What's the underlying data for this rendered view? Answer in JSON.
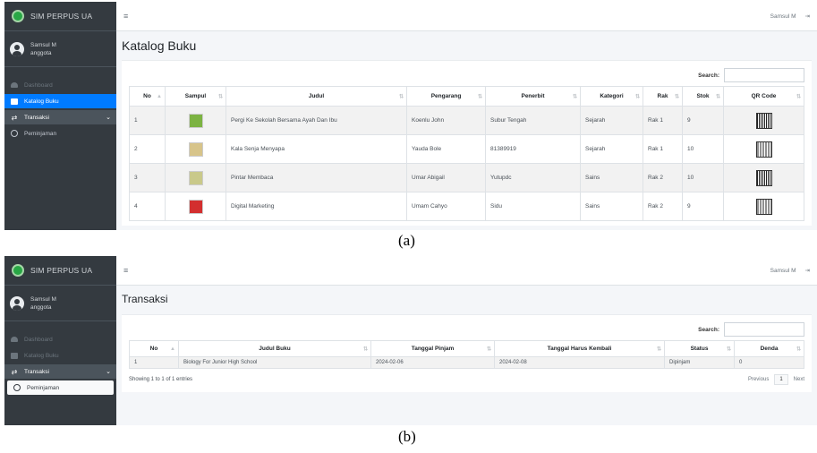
{
  "panel_a": {
    "brand": "SIM PERPUS UA",
    "user": {
      "name": "Samsul M",
      "role": "anggota"
    },
    "nav": [
      {
        "label": "Dashboard",
        "icon": "dashboard-icon"
      },
      {
        "label": "Katalog Buku",
        "icon": "book-icon"
      },
      {
        "label": "Transaksi",
        "icon": "exchange-icon"
      },
      {
        "label": "Peminjaman",
        "icon": "circle-icon"
      }
    ],
    "topbar_user": "Samsul M",
    "page_title": "Katalog Buku",
    "search_label": "Search:",
    "columns": [
      "No",
      "Sampul",
      "Judul",
      "Pengarang",
      "Penerbit",
      "Kategori",
      "Rak",
      "Stok",
      "QR Code"
    ],
    "rows": [
      {
        "no": "1",
        "cover_color": "#7cb342",
        "judul": "Pergi Ke Sekolah Bersama Ayah Dan Ibu",
        "pengarang": "Koenlu John",
        "penerbit": "Subur Tengah",
        "kategori": "Sejarah",
        "rak": "Rak 1",
        "stok": "9"
      },
      {
        "no": "2",
        "cover_color": "#d7c48a",
        "judul": "Kala Senja Menyapa",
        "pengarang": "Yauda Bole",
        "penerbit": "81389919",
        "kategori": "Sejarah",
        "rak": "Rak 1",
        "stok": "10"
      },
      {
        "no": "3",
        "cover_color": "#c9c98a",
        "judul": "Pintar Membaca",
        "pengarang": "Umar Abigail",
        "penerbit": "Yutupdc",
        "kategori": "Sains",
        "rak": "Rak 2",
        "stok": "10"
      },
      {
        "no": "4",
        "cover_color": "#d32f2f",
        "judul": "Digital Marketing",
        "pengarang": "Umam Cahyo",
        "penerbit": "Sidu",
        "kategori": "Sains",
        "rak": "Rak 2",
        "stok": "9"
      }
    ],
    "caption": "(a)"
  },
  "panel_b": {
    "brand": "SIM PERPUS UA",
    "user": {
      "name": "Samsul M",
      "role": "anggota"
    },
    "nav": [
      {
        "label": "Dashboard",
        "icon": "dashboard-icon"
      },
      {
        "label": "Katalog Buku",
        "icon": "book-icon"
      },
      {
        "label": "Transaksi",
        "icon": "exchange-icon"
      },
      {
        "label": "Peminjaman",
        "icon": "circle-icon"
      }
    ],
    "topbar_user": "Samsul M",
    "page_title": "Transaksi",
    "search_label": "Search:",
    "columns": [
      "No",
      "Judul Buku",
      "Tanggal Pinjam",
      "Tanggal Harus Kembali",
      "Status",
      "Denda"
    ],
    "rows": [
      {
        "no": "1",
        "judul": "Biology For Junior High School",
        "pinjam": "2024-02-06",
        "kembali": "2024-02-08",
        "status": "Dipinjam",
        "denda": "0"
      }
    ],
    "info": "Showing 1 to 1 of 1 entries",
    "pager": {
      "previous": "Previous",
      "page": "1",
      "next": "Next"
    },
    "caption": "(b)"
  },
  "colors": {
    "sidebar": "#343a40",
    "active": "#007bff",
    "content_bg": "#f4f6f9"
  }
}
